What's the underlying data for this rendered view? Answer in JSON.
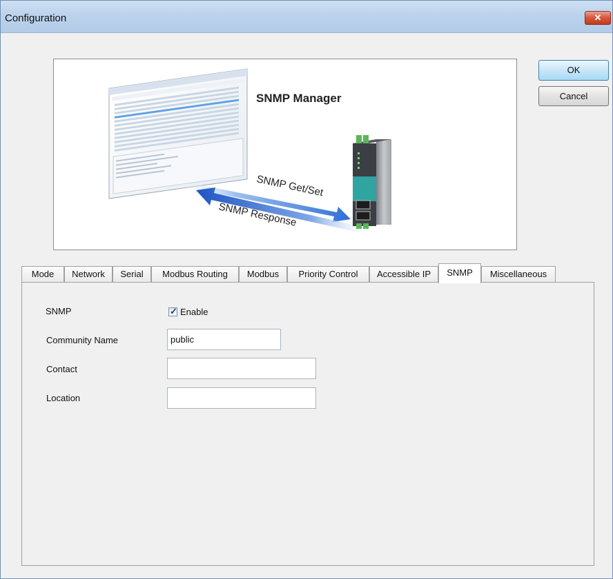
{
  "window": {
    "title": "Configuration"
  },
  "titlebar": {
    "close_glyph": "✕",
    "close_icon": "close-icon"
  },
  "banner": {
    "heading": "SNMP Manager",
    "arrow_top_label": "SNMP Get/Set",
    "arrow_bottom_label": "SNMP Response"
  },
  "buttons": {
    "ok": "OK",
    "cancel": "Cancel"
  },
  "tabs": [
    {
      "label": "Mode"
    },
    {
      "label": "Network"
    },
    {
      "label": "Serial"
    },
    {
      "label": "Modbus Routing"
    },
    {
      "label": "Modbus"
    },
    {
      "label": "Priority Control"
    },
    {
      "label": "Accessible IP"
    },
    {
      "label": "SNMP"
    },
    {
      "label": "Miscellaneous"
    }
  ],
  "active_tab": "SNMP",
  "snmp": {
    "snmp_label": "SNMP",
    "enable_label": "Enable",
    "enable_checked": true,
    "community_label": "Community Name",
    "community_value": "public",
    "contact_label": "Contact",
    "contact_value": "",
    "location_label": "Location",
    "location_value": ""
  },
  "colors": {
    "titlebar": "#bcd3ec",
    "close_button": "#d5563b",
    "arrow_blue": "#2f6fd6",
    "device_accent": "#2fa4a0"
  }
}
